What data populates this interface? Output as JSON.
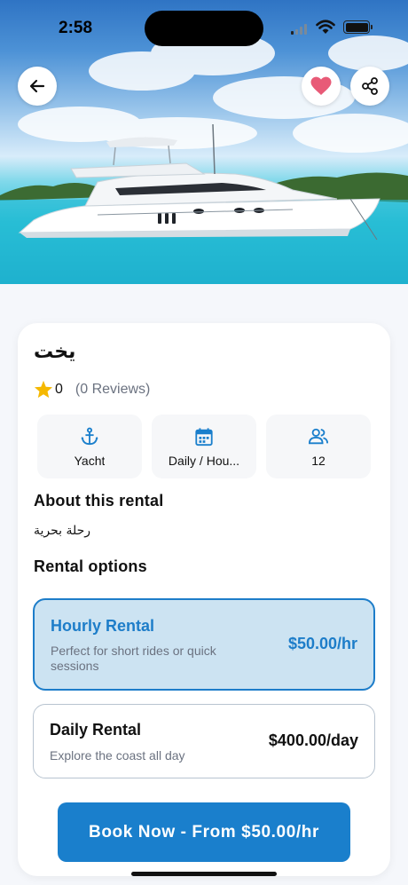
{
  "status_bar": {
    "time": "2:58"
  },
  "listing": {
    "title": "يخت",
    "rating": "0",
    "reviews": "(0 Reviews)"
  },
  "features": [
    {
      "icon": "anchor-icon",
      "label": "Yacht"
    },
    {
      "icon": "calendar-icon",
      "label": "Daily / Hou..."
    },
    {
      "icon": "people-icon",
      "label": "12"
    }
  ],
  "about": {
    "title": "About this rental",
    "text": "رحلة بحرية"
  },
  "options": {
    "title": "Rental options",
    "items": [
      {
        "name": "Hourly Rental",
        "description": "Perfect for short rides or quick sessions",
        "price": "$50.00/hr",
        "selected": true
      },
      {
        "name": "Daily Rental",
        "description": "Explore the coast all day",
        "price": "$400.00/day",
        "selected": false
      }
    ]
  },
  "book_button": {
    "label": "Book Now - From $50.00/hr"
  },
  "colors": {
    "accent": "#1a7fcc",
    "selected_bg": "#cce3f2",
    "heart": "#e85a77",
    "star": "#f5b800"
  }
}
